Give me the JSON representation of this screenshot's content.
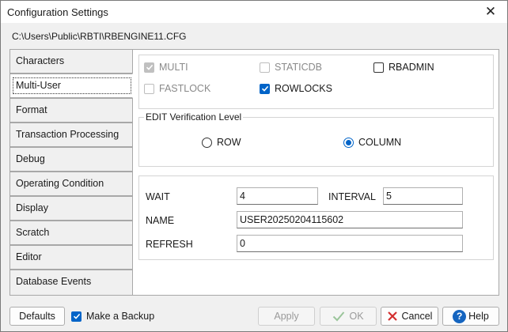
{
  "window": {
    "title": "Configuration Settings",
    "file_path": "C:\\Users\\Public\\RBTI\\RBENGINE11.CFG"
  },
  "nav": {
    "items": [
      {
        "label": "Characters",
        "active": false
      },
      {
        "label": "Multi-User",
        "active": true
      },
      {
        "label": "Format",
        "active": false
      },
      {
        "label": "Transaction Processing",
        "active": false
      },
      {
        "label": "Debug",
        "active": false
      },
      {
        "label": "Operating Condition",
        "active": false
      },
      {
        "label": "Display",
        "active": false
      },
      {
        "label": "Scratch",
        "active": false
      },
      {
        "label": "Editor",
        "active": false
      },
      {
        "label": "Database Events",
        "active": false
      }
    ]
  },
  "options": {
    "multi": {
      "label": "MULTI",
      "checked": true,
      "enabled": false
    },
    "staticdb": {
      "label": "STATICDB",
      "checked": false,
      "enabled": false
    },
    "rbadmin": {
      "label": "RBADMIN",
      "checked": false,
      "enabled": true
    },
    "fastlock": {
      "label": "FASTLOCK",
      "checked": false,
      "enabled": false
    },
    "rowlocks": {
      "label": "ROWLOCKS",
      "checked": true,
      "enabled": true
    }
  },
  "edit_verification": {
    "legend": "EDIT Verification Level",
    "row_label": "ROW",
    "column_label": "COLUMN",
    "selected": "COLUMN"
  },
  "fields": {
    "wait_label": "WAIT",
    "wait_value": "4",
    "interval_label": "INTERVAL",
    "interval_value": "5",
    "name_label": "NAME",
    "name_value": "USER20250204115602",
    "refresh_label": "REFRESH",
    "refresh_value": "0"
  },
  "footer": {
    "defaults_label": "Defaults",
    "backup_label": "Make a Backup",
    "backup_checked": true,
    "apply_label": "Apply",
    "ok_label": "OK",
    "cancel_label": "Cancel",
    "help_label": "Help",
    "help_icon_glyph": "?"
  },
  "icons": {
    "close": "close-icon",
    "ok": "checkmark-icon",
    "cancel": "x-icon",
    "help": "help-icon"
  },
  "colors": {
    "accent": "#0064c8",
    "cancel_red": "#d32f2f",
    "ok_green": "#9bc59b"
  }
}
